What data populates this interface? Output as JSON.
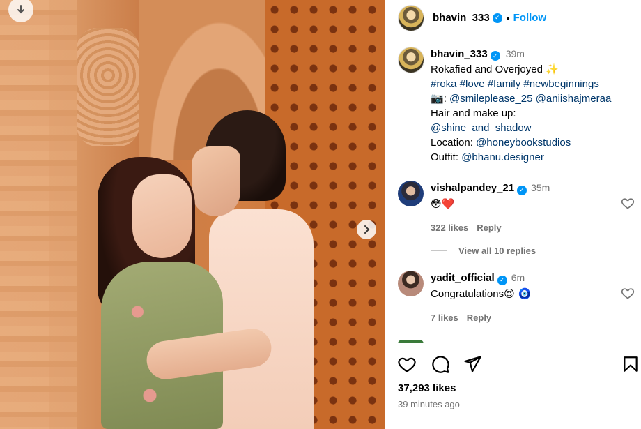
{
  "post": {
    "author": "bhavin_333",
    "follow_label": "Follow",
    "separator": "•"
  },
  "caption": {
    "username": "bhavin_333",
    "time": "39m",
    "line1": "Rokafied and Overjoyed",
    "line1_emoji": "✨",
    "hashtags": "#roka #love #family #newbeginnings",
    "camera_emoji": "📷",
    "credit_sep": ": ",
    "photographer_1": "@smileplease_25",
    "photographer_2": "@aniishajmeraa",
    "hair_label": "Hair and make up:",
    "hair_handle": "@shine_and_shadow_",
    "location_label": "Location:",
    "location_handle": "@honeybookstudios",
    "outfit_label": "Outfit:",
    "outfit_handle": "@bhanu.designer"
  },
  "comments": [
    {
      "username": "vishalpandey_21",
      "time": "35m",
      "text": "😳❤️",
      "likes": "322 likes",
      "reply": "Reply"
    },
    {
      "username": "yadit_official",
      "time": "6m",
      "text": "Congratulations",
      "text_emoji": "😍 🧿",
      "likes": "7 likes",
      "reply": "Reply"
    }
  ],
  "view_replies": "View all 10 replies",
  "footer": {
    "likes": "37,293 likes",
    "posted_ago": "39 minutes ago"
  },
  "colors": {
    "accent": "#0095f6",
    "link": "#00376b",
    "muted": "#737373"
  }
}
